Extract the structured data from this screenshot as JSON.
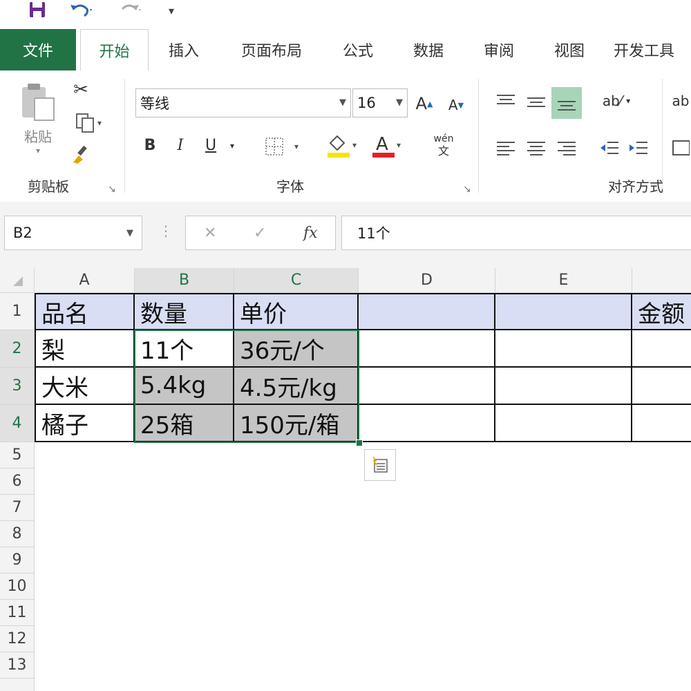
{
  "quick_access": {
    "icons": [
      "save-icon",
      "undo-icon",
      "redo-icon",
      "customize-icon"
    ]
  },
  "tabs": [
    {
      "label": "文件"
    },
    {
      "label": "开始"
    },
    {
      "label": "插入"
    },
    {
      "label": "页面布局"
    },
    {
      "label": "公式"
    },
    {
      "label": "数据"
    },
    {
      "label": "审阅"
    },
    {
      "label": "视图"
    },
    {
      "label": "开发工具"
    }
  ],
  "ribbon": {
    "clipboard": {
      "label": "剪贴板",
      "paste_label": "粘贴"
    },
    "font": {
      "label": "字体",
      "font_name": "等线",
      "font_size": "16",
      "bold": "B",
      "italic": "I",
      "underline": "U",
      "phonetic_top": "wén",
      "phonetic_bottom": "文"
    },
    "alignment": {
      "label": "对齐方式"
    },
    "colors": {
      "fill_color": "#f5e400",
      "font_color": "#e0202a",
      "accent": "#217346"
    }
  },
  "formula_bar": {
    "name_box": "B2",
    "cancel": "✕",
    "enter": "✓",
    "fx": "fx",
    "value": "11个"
  },
  "grid": {
    "columns": [
      "A",
      "B",
      "C",
      "D",
      "E"
    ],
    "rows": [
      "1",
      "2",
      "3",
      "4",
      "5",
      "6",
      "7",
      "8",
      "9",
      "10",
      "11",
      "12",
      "13"
    ],
    "cells": {
      "A1": "品名",
      "B1": "数量",
      "C1": "单价",
      "F1": "金额",
      "A2": "梨",
      "B2": "11个",
      "C2": "36元/个",
      "A3": "大米",
      "B3": "5.4kg",
      "C3": "4.5元/kg",
      "A4": "橘子",
      "B4": "25箱",
      "C4": "150元/箱"
    }
  }
}
